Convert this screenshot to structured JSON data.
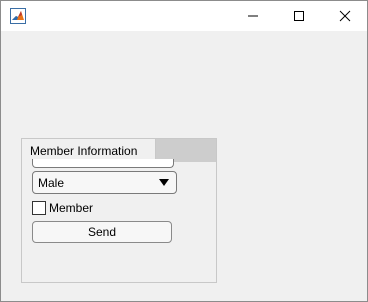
{
  "window": {
    "icons": {
      "app": "matlab-logo-icon",
      "minimize": "minimize-icon",
      "maximize": "maximize-icon",
      "close": "close-icon"
    }
  },
  "tab_group": {
    "tab_label": "Member Information"
  },
  "form": {
    "name_value": "",
    "gender_dropdown": {
      "selected": "Male"
    },
    "member_checkbox": {
      "label": "Member",
      "checked": false
    },
    "send_button_label": "Send"
  },
  "colors": {
    "window_bg": "#f0f0f0",
    "titlebar_bg": "#ffffff",
    "tab_strip_bg": "#cdcdcd",
    "border": "#c8c8c8"
  }
}
